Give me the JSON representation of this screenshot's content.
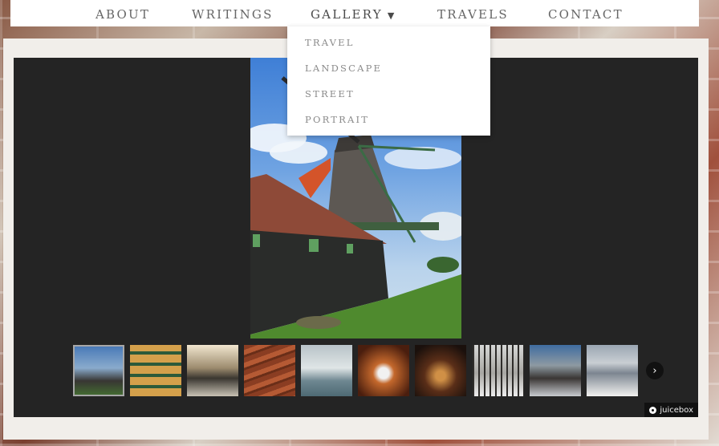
{
  "nav": {
    "items": [
      {
        "label": "ABOUT"
      },
      {
        "label": "WRITINGS"
      },
      {
        "label": "GALLERY",
        "caret": "▼"
      },
      {
        "label": "TRAVELS"
      },
      {
        "label": "CONTACT"
      }
    ]
  },
  "gallery_menu": {
    "items": [
      {
        "label": "TRAVEL"
      },
      {
        "label": "LANDSCAPE"
      },
      {
        "label": "STREET"
      },
      {
        "label": "PORTRAIT"
      }
    ]
  },
  "viewer": {
    "main_image": "windmill-photo",
    "thumbnails": [
      {
        "subject": "windmill"
      },
      {
        "subject": "market-produce"
      },
      {
        "subject": "train-station"
      },
      {
        "subject": "wood-planks"
      },
      {
        "subject": "seagulls-sea"
      },
      {
        "subject": "drone"
      },
      {
        "subject": "night-street"
      },
      {
        "subject": "snowy-forest"
      },
      {
        "subject": "mountain-car"
      },
      {
        "subject": "snowy-mountain"
      }
    ],
    "next_icon": "›",
    "badge": "juicebox"
  }
}
